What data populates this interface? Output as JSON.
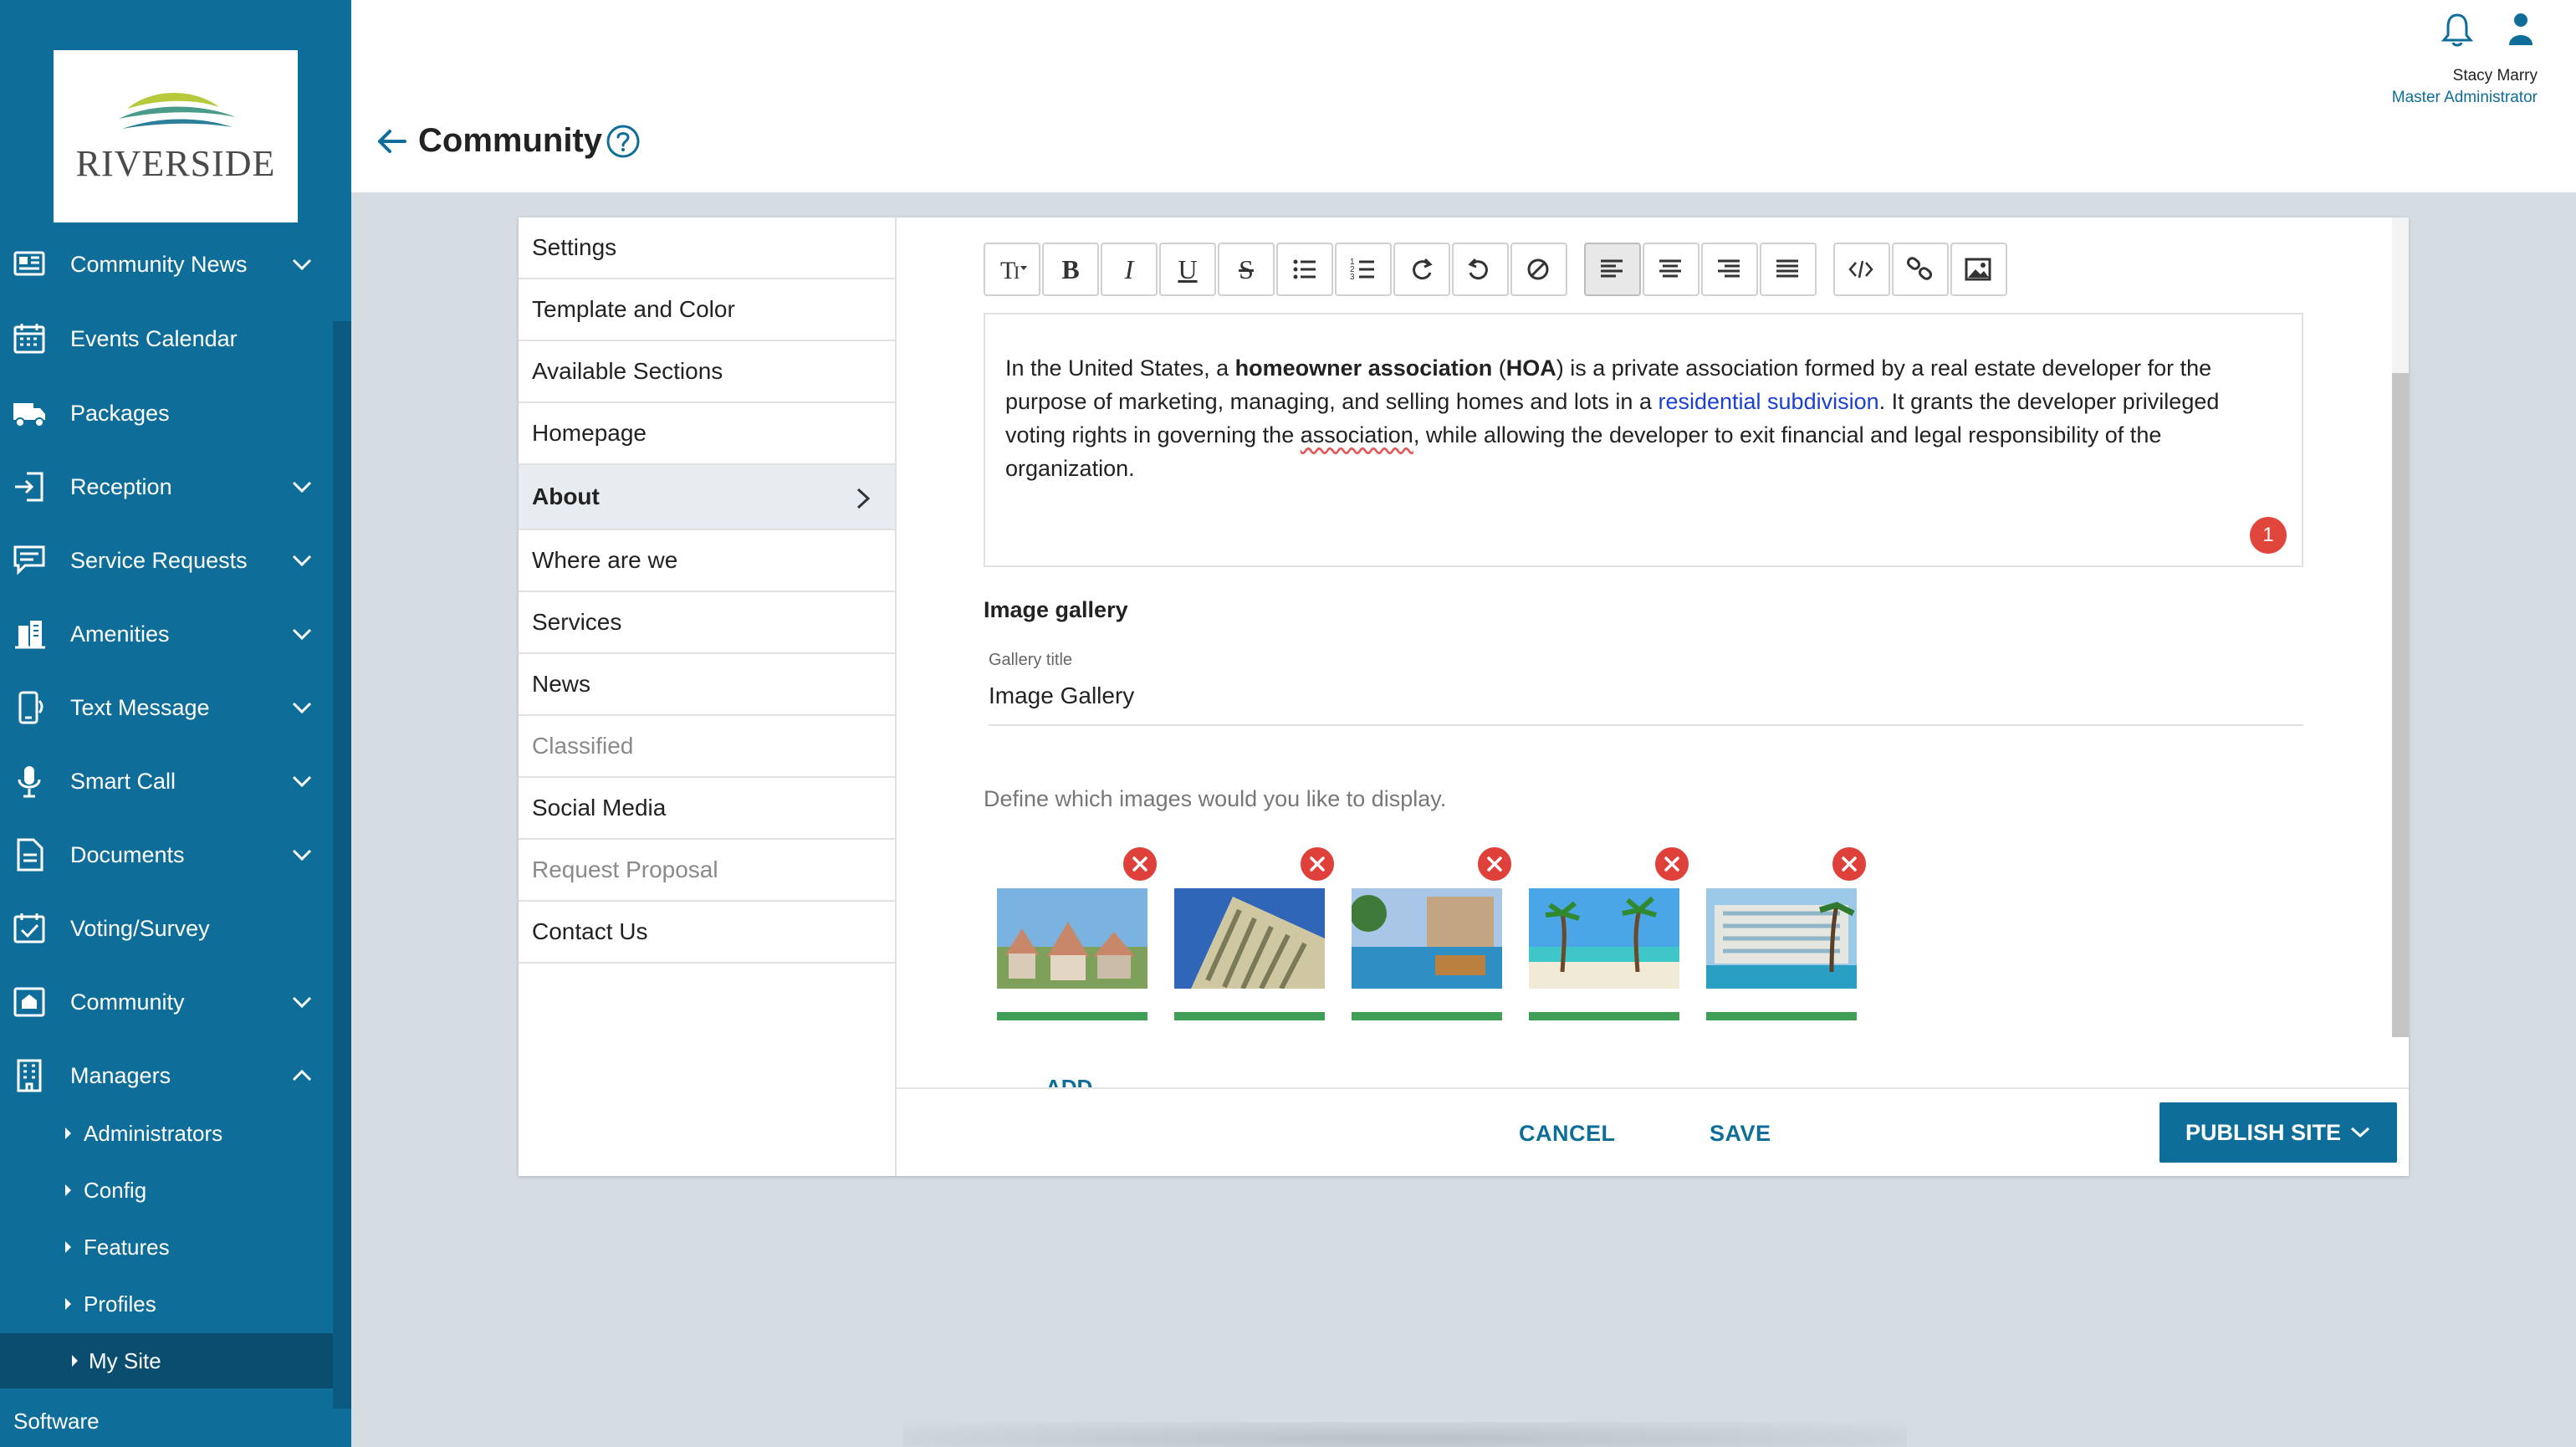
{
  "brand": {
    "logo_text": "RIVERSIDE"
  },
  "sidebar": {
    "items": [
      {
        "label": "Community News",
        "icon": "newspaper-icon",
        "expandable": true
      },
      {
        "label": "Events Calendar",
        "icon": "calendar-icon",
        "expandable": false
      },
      {
        "label": "Packages",
        "icon": "truck-icon",
        "expandable": false
      },
      {
        "label": "Reception",
        "icon": "door-enter-icon",
        "expandable": true
      },
      {
        "label": "Service Requests",
        "icon": "chat-request-icon",
        "expandable": true
      },
      {
        "label": "Amenities",
        "icon": "building-icon",
        "expandable": true
      },
      {
        "label": "Text Message",
        "icon": "phone-message-icon",
        "expandable": true
      },
      {
        "label": "Smart Call",
        "icon": "microphone-icon",
        "expandable": true
      },
      {
        "label": "Documents",
        "icon": "document-icon",
        "expandable": true
      },
      {
        "label": "Voting/Survey",
        "icon": "calendar-check-icon",
        "expandable": false
      },
      {
        "label": "Community",
        "icon": "community-icon",
        "expandable": true
      },
      {
        "label": "Managers",
        "icon": "managers-icon",
        "expandable": true,
        "expanded": true
      }
    ],
    "subitems": [
      {
        "label": "Administrators"
      },
      {
        "label": "Config"
      },
      {
        "label": "Features"
      },
      {
        "label": "Profiles"
      },
      {
        "label": "My Site",
        "active": true
      }
    ],
    "footer_label": "Software"
  },
  "header": {
    "title": "Community",
    "user_name": "Stacy Marry",
    "user_role": "Master Administrator"
  },
  "section_menu": {
    "items": [
      {
        "label": "Settings"
      },
      {
        "label": "Template and Color"
      },
      {
        "label": "Available Sections"
      },
      {
        "label": "Homepage"
      },
      {
        "label": "About",
        "active": true
      },
      {
        "label": "Where are we"
      },
      {
        "label": "Services"
      },
      {
        "label": "News"
      },
      {
        "label": "Classified",
        "muted": true
      },
      {
        "label": "Social Media"
      },
      {
        "label": "Request Proposal",
        "muted": true
      },
      {
        "label": "Contact Us"
      }
    ]
  },
  "toolbar": {
    "buttons": [
      {
        "name": "text-size-button",
        "icon": "text-size-icon"
      },
      {
        "name": "bold-button",
        "glyph": "B"
      },
      {
        "name": "italic-button",
        "glyph": "I"
      },
      {
        "name": "underline-button",
        "glyph": "U"
      },
      {
        "name": "strikethrough-button",
        "glyph": "S"
      },
      {
        "name": "bullet-list-button",
        "icon": "bullet-list-icon"
      },
      {
        "name": "numbered-list-button",
        "icon": "numbered-list-icon"
      },
      {
        "name": "redo-button",
        "icon": "redo-icon"
      },
      {
        "name": "undo-button",
        "icon": "undo-icon"
      },
      {
        "name": "clear-format-button",
        "icon": "clear-format-icon"
      },
      {
        "name": "align-left-button",
        "icon": "align-left-icon",
        "active": true
      },
      {
        "name": "align-center-button",
        "icon": "align-center-icon"
      },
      {
        "name": "align-right-button",
        "icon": "align-right-icon"
      },
      {
        "name": "align-justify-button",
        "icon": "align-justify-icon"
      },
      {
        "name": "code-button",
        "icon": "code-icon"
      },
      {
        "name": "link-button",
        "icon": "link-icon"
      },
      {
        "name": "image-button",
        "icon": "image-icon"
      }
    ]
  },
  "editor": {
    "t1": "In the United States, a ",
    "b1": "homeowner association",
    "t2": " (",
    "b2": "HOA",
    "t3": ") is a private association formed by a real estate developer for the purpose of marketing, managing, and selling homes and lots in a ",
    "link": "residential subdivision",
    "t4": ". It grants the developer privileged voting rights in governing the ",
    "spell": "association",
    "t5": ", while allowing the developer to exit financial and legal responsibility of the organization.",
    "badge_count": "1"
  },
  "gallery": {
    "section_title": "Image gallery",
    "field_label": "Gallery title",
    "field_value": "Image Gallery",
    "hint": "Define which images would you like to display.",
    "images": [
      {
        "name": "houses-photo"
      },
      {
        "name": "building-photo"
      },
      {
        "name": "pool-resort-photo"
      },
      {
        "name": "beach-palms-photo"
      },
      {
        "name": "hotel-palms-photo"
      }
    ],
    "add_label": "ADD"
  },
  "actions": {
    "cancel": "CANCEL",
    "save": "SAVE",
    "publish": "PUBLISH SITE"
  },
  "colors": {
    "sidebar": "#0f6e99",
    "accent": "#0f6e99",
    "delete": "#e0403a",
    "upload_bar": "#3f9f56"
  }
}
